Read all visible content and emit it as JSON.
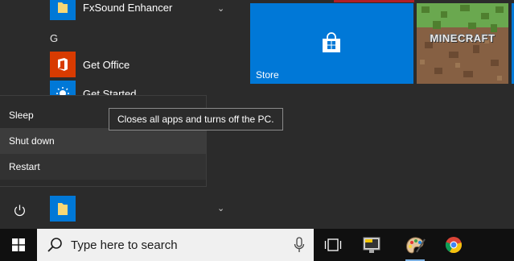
{
  "app_list": {
    "fxsound": "FxSound Enhancer",
    "section_g": "G",
    "get_office": "Get Office",
    "get_started": "Get Started"
  },
  "tiles": {
    "store": "Store",
    "minecraft": "MINECRAFT"
  },
  "power_menu": {
    "sleep": "Sleep",
    "shutdown": "Shut down",
    "restart": "Restart",
    "tooltip": "Closes all apps and turns off the PC."
  },
  "taskbar": {
    "search_placeholder": "Type here to search"
  },
  "colors": {
    "accent": "#0078d7",
    "office": "#d83b01",
    "folder": "#f8d775",
    "menu_bg": "#2b2b2b",
    "taskbar_bg": "#101010"
  },
  "icons": [
    "windows-logo-icon",
    "search-icon",
    "microphone-icon",
    "task-view-icon",
    "power-icon",
    "chevron-down-icon",
    "folder-icon",
    "office-icon",
    "lightbulb-icon",
    "store-bag-icon",
    "chrome-icon",
    "paint-icon"
  ]
}
